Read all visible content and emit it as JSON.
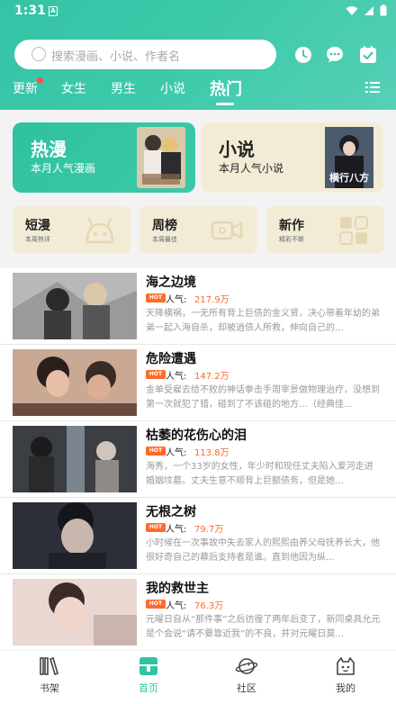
{
  "status_bar": {
    "time": "1:31",
    "notification_letter": "A"
  },
  "search": {
    "placeholder": "搜索漫画、小说、作者名"
  },
  "header_icons": [
    "clock-icon",
    "message-icon",
    "checkin-icon"
  ],
  "tabs": [
    {
      "label": "更新",
      "has_dot": true
    },
    {
      "label": "女生"
    },
    {
      "label": "男生"
    },
    {
      "label": "小说"
    },
    {
      "label": "热门",
      "active": true
    }
  ],
  "hero": {
    "hot": {
      "title": "热漫",
      "subtitle": "本月人气漫画"
    },
    "novel": {
      "title": "小说",
      "subtitle": "本月人气小说",
      "cover_text": "横行八方"
    }
  },
  "categories": [
    {
      "title": "短漫",
      "subtitle": "本周热评"
    },
    {
      "title": "周榜",
      "subtitle": "本周最佳"
    },
    {
      "title": "新作",
      "subtitle": "精彩不断"
    }
  ],
  "list": {
    "hot_badge": "HOT",
    "popularity_label": "人气:",
    "items": [
      {
        "title": "海之边境",
        "popularity": "217.9万",
        "description": "天降横祸，一无所有背上巨债的金义贤，决心带着年幼的弟弟一起入海自杀，却被逍债人所救，伸向自己的..."
      },
      {
        "title": "危险遭遇",
        "popularity": "147.2万",
        "description": "金单受雇去给不败的神话拳击手周宰景做物理治疗，没想到第一次就犯了错，碰到了不该碰的地方…（经典佳..."
      },
      {
        "title": "枯萎的花伤心的泪",
        "popularity": "113.8万",
        "description": "海秀，一个33岁的女性，年少时和现任丈夫陷入爱河走进婚姻坟墓。丈夫生意不顺背上巨额债务，但是她..."
      },
      {
        "title": "无根之树",
        "popularity": "79.7万",
        "description": "小时候在一次事故中失去家人的熙熙由养父母抚养长大，他很好奇自己的幕后支持者是谁。直到他因为纵..."
      },
      {
        "title": "我的救世主",
        "popularity": "76.3万",
        "description": "元曜日自从“那件事”之后彷徨了两年后变了，新同桌具允元是个会说“请不要靠近我”的不良，并对元曜日莫..."
      }
    ]
  },
  "bottom_nav": [
    {
      "label": "书架",
      "icon": "bookshelf-icon"
    },
    {
      "label": "首页",
      "icon": "home-icon",
      "active": true
    },
    {
      "label": "社区",
      "icon": "community-icon"
    },
    {
      "label": "我的",
      "icon": "profile-icon"
    }
  ],
  "colors": {
    "accent": "#33c3a2",
    "hot": "#ff6a2a",
    "cream": "#f2ecd7",
    "dot": "#ff4d4d"
  }
}
